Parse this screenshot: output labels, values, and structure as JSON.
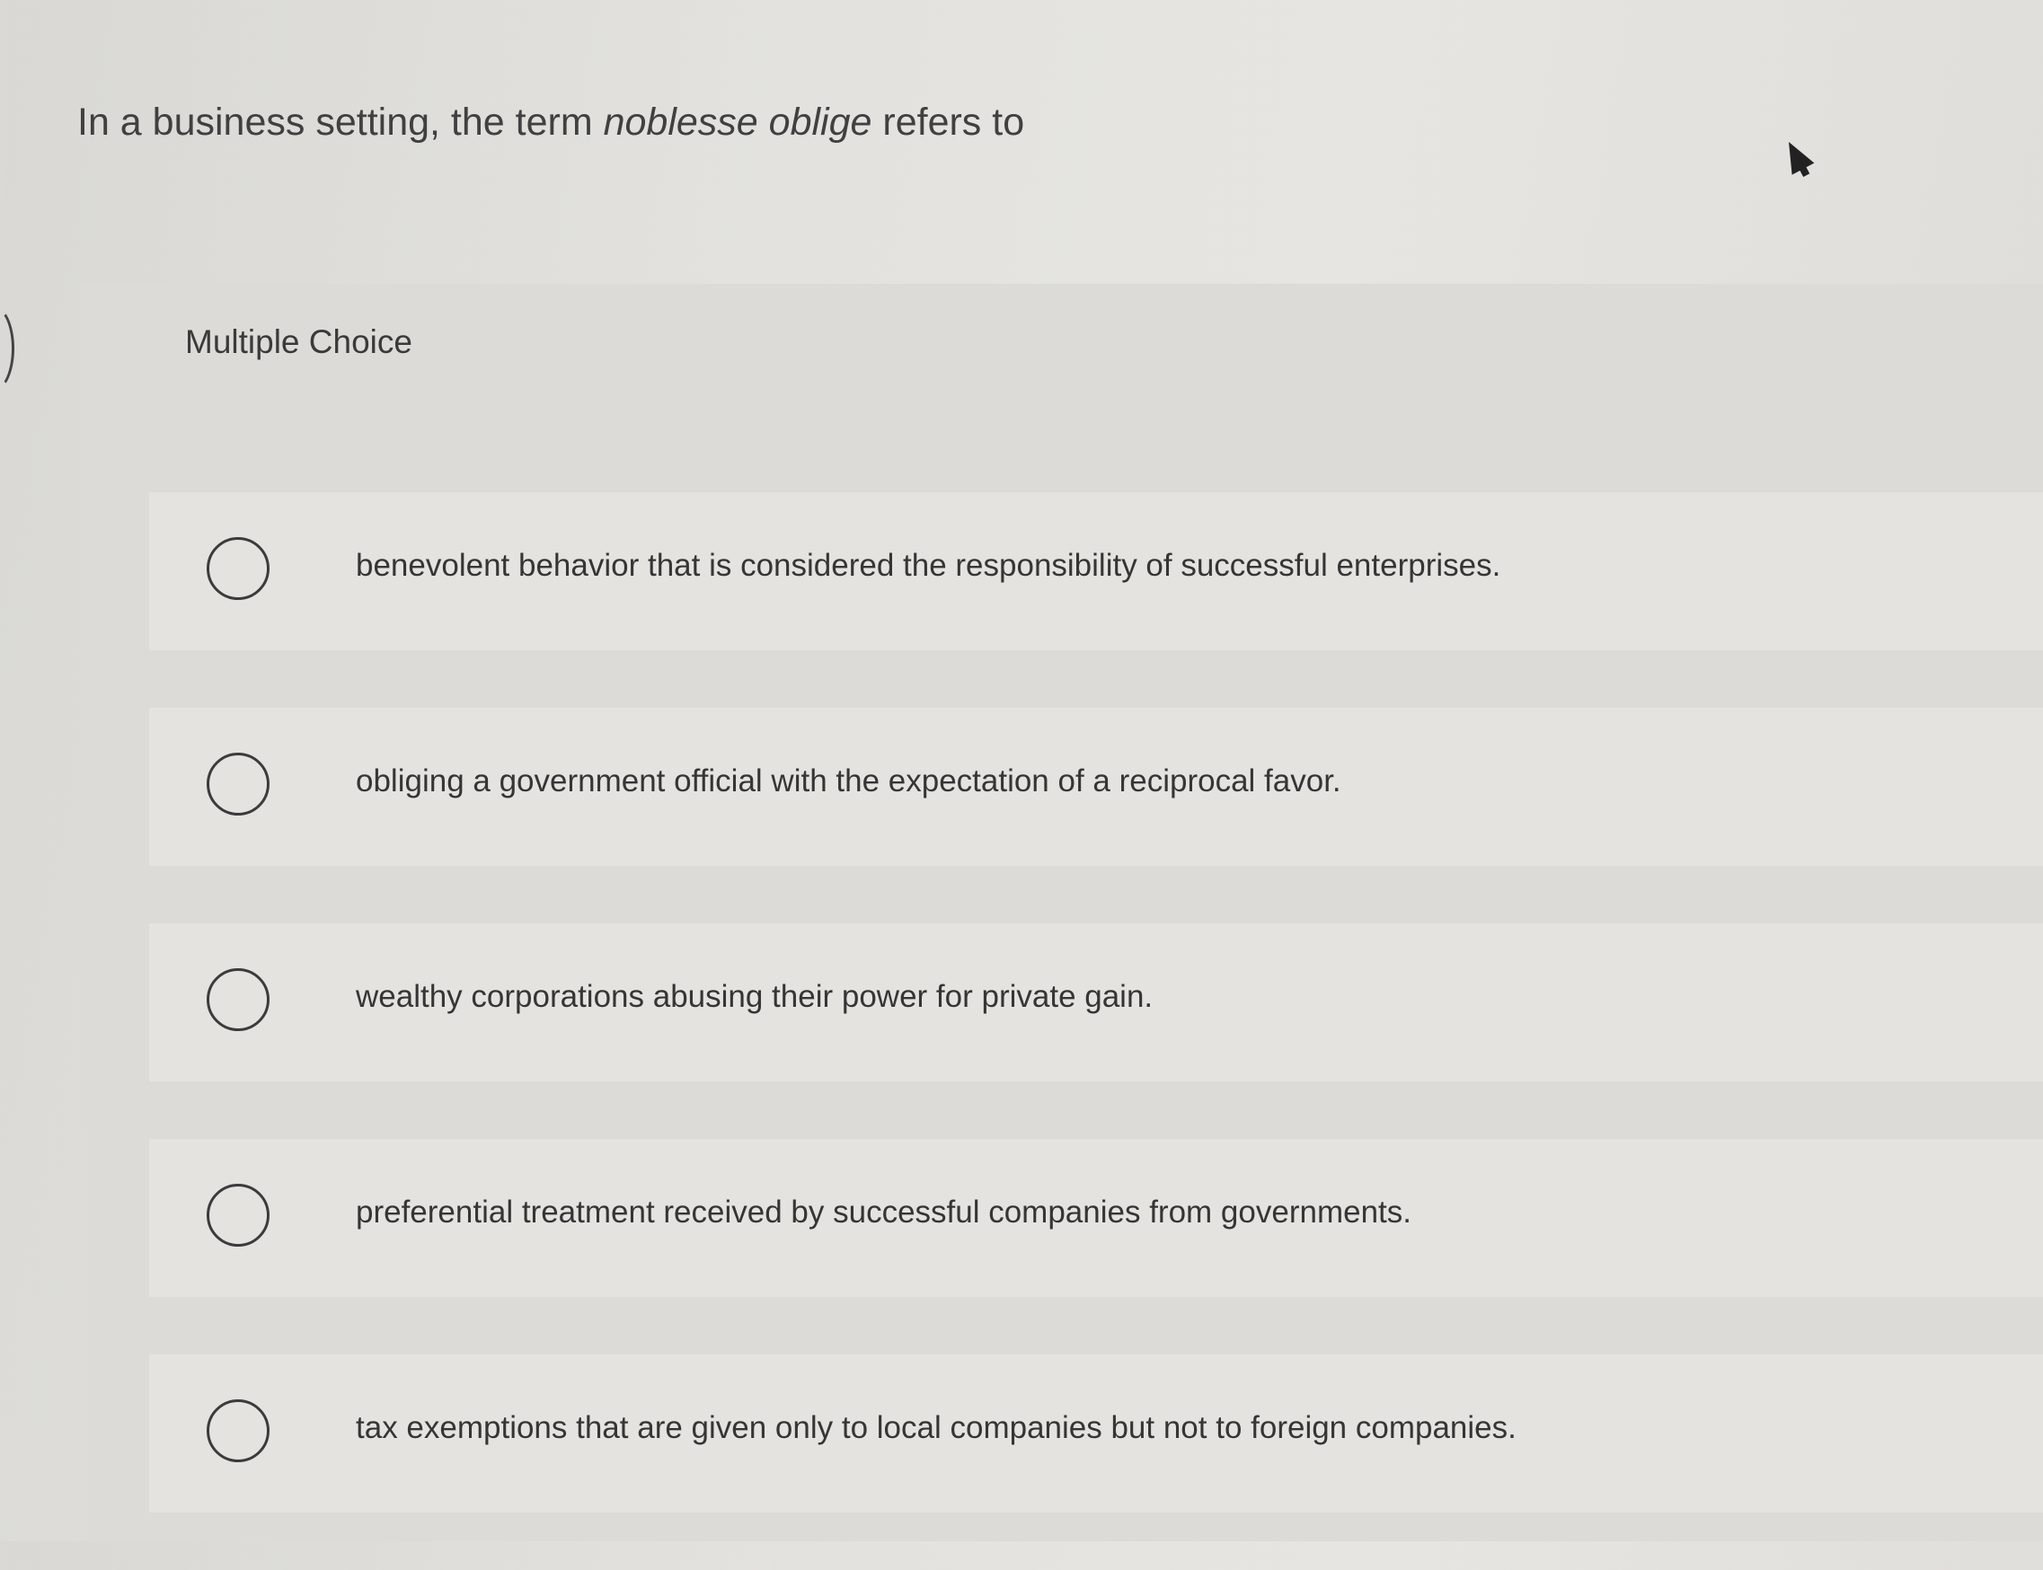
{
  "question": {
    "before": "In a business setting, the term ",
    "term": "noblesse oblige",
    "after": " refers to"
  },
  "section": {
    "label": "Multiple Choice"
  },
  "choices": [
    {
      "text": "benevolent behavior that is considered the responsibility of successful enterprises."
    },
    {
      "text": "obliging a government official with the expectation of a reciprocal favor."
    },
    {
      "text": "wealthy corporations abusing their power for private gain."
    },
    {
      "text": "preferential treatment received by successful companies from governments."
    },
    {
      "text": "tax exemptions that are given only to local companies but not to foreign companies."
    }
  ],
  "icons": {
    "cursor": "mouse-cursor-icon",
    "radio": "radio-button-icon"
  }
}
